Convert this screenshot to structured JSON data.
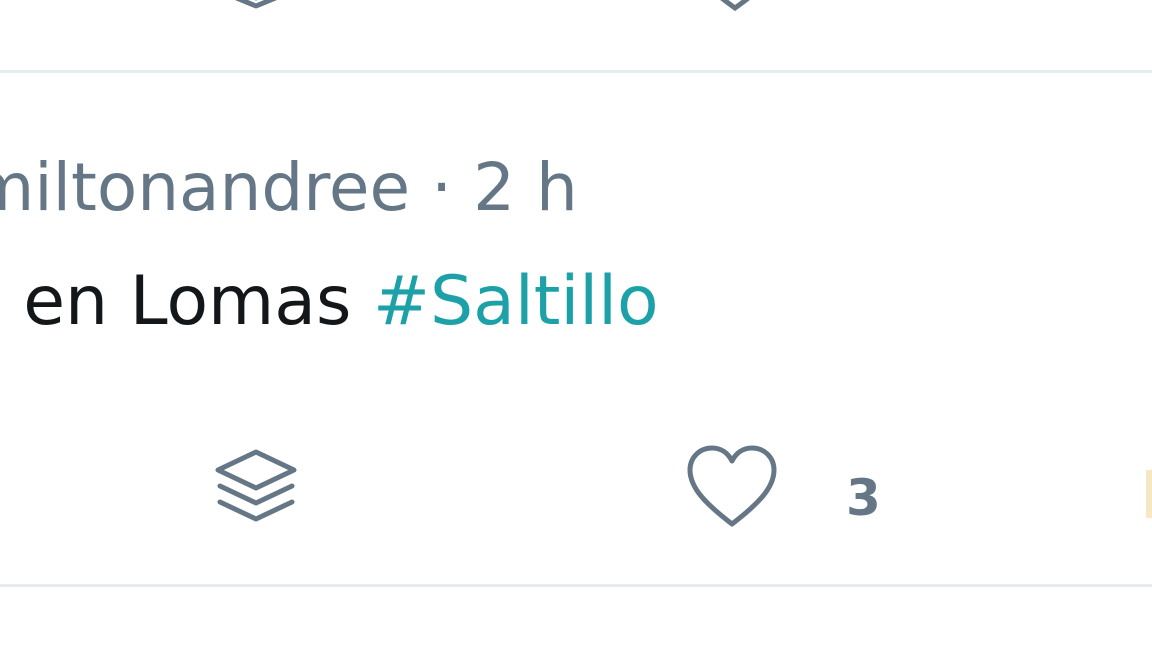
{
  "previous_tweet": {
    "icons": [
      "layers-icon",
      "heart-icon"
    ]
  },
  "tweet": {
    "username_partial": "miltonandree",
    "separator": "·",
    "time": "2 h",
    "text_partial": "o en Lomas ",
    "hashtag": "#Saltillo",
    "actions": {
      "layers_icon": "layers-icon",
      "like_icon": "heart-icon",
      "like_count": "3"
    }
  },
  "colors": {
    "meta_text": "#657786",
    "body_text": "#14171a",
    "hashtag": "#1da1a8",
    "divider": "#e6ecf0"
  }
}
